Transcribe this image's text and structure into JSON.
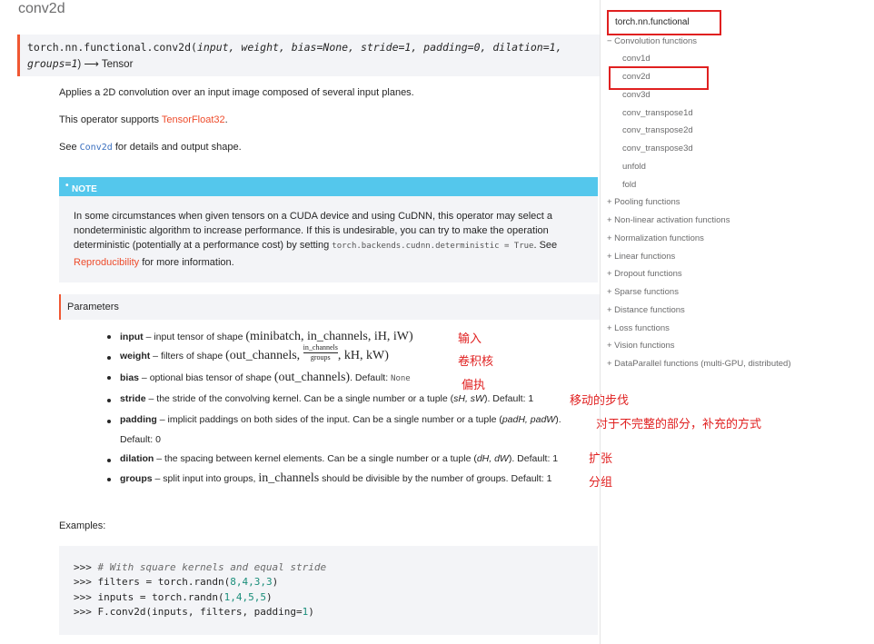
{
  "page": {
    "title": "conv2d"
  },
  "signature": {
    "prefix": "torch.nn.functional.conv2d(",
    "args_line1": "input, weight, bias=None, stride=1, padding=0, dilation=1,",
    "args_line2": "groups=1",
    "suffix": ") ⟶ Tensor"
  },
  "desc": {
    "line1": "Applies a 2D convolution over an input image composed of several input planes.",
    "line2_pre": "This operator supports ",
    "line2_link": "TensorFloat32",
    "line2_post": ".",
    "line3_pre": "See ",
    "line3_code": "Conv2d",
    "line3_post": " for details and output shape."
  },
  "note": {
    "heading": "NOTE",
    "l1": "In some circumstances when given tensors on a CUDA device and using CuDNN, this operator may select a",
    "l2": "nondeterministic algorithm to increase performance. If this is undesirable, you can try to make the operation",
    "l3_pre": "deterministic (potentially at a performance cost) by setting ",
    "l3_code": "torch.backends.cudnn.deterministic = True",
    "l3_post": ". See",
    "l4_link": "Reproducibility",
    "l4_post": " for more information."
  },
  "parameters": {
    "heading": "Parameters",
    "items": [
      {
        "name": "input",
        "sep": " – ",
        "desc": "input tensor of shape ",
        "math": "(minibatch, in_channels, iH, iW)"
      },
      {
        "name": "weight",
        "sep": " – ",
        "desc": "filters of shape ",
        "math_pre": "(out_channels, ",
        "frac_num": "in_channels",
        "frac_den": "groups",
        "math_post": ", kH, kW)"
      },
      {
        "name": "bias",
        "sep": " – ",
        "desc": "optional bias tensor of shape ",
        "math": "(out_channels)",
        "after": ". Default: ",
        "default_code": "None"
      },
      {
        "name": "stride",
        "sep": " – ",
        "desc": "the stride of the convolving kernel. Can be a single number or a tuple (",
        "math_it": "sH, sW",
        "after": "). Default: 1"
      },
      {
        "name": "padding",
        "sep": " – ",
        "desc": "implicit paddings on both sides of the input. Can be a single number or a tuple (",
        "math_it": "padH, padW",
        "after": ").",
        "cont": "Default: 0"
      },
      {
        "name": "dilation",
        "sep": " – ",
        "desc": "the spacing between kernel elements. Can be a single number or a tuple (",
        "math_it": "dH, dW",
        "after": "). Default: 1"
      },
      {
        "name": "groups",
        "sep": " – ",
        "desc": "split input into groups, ",
        "math": "in_channels",
        "after": " should be divisible by the number of groups. Default: 1"
      }
    ]
  },
  "annotations": [
    "输入",
    "卷积核",
    "偏执",
    "移动的步伐",
    "对于不完整的部分，补充的方式",
    "扩张",
    "分组"
  ],
  "examples": {
    "label": "Examples:",
    "lines": [
      {
        "prompt": ">>> ",
        "comment": "# With square kernels and equal stride"
      },
      {
        "prompt": ">>> ",
        "pre": "filters = torch.randn(",
        "nums": "8,4,3,3",
        "post": ")"
      },
      {
        "prompt": ">>> ",
        "pre": "inputs = torch.randn(",
        "nums": "1,4,5,5",
        "post": ")"
      },
      {
        "prompt": ">>> ",
        "pre": "F.conv2d(inputs, filters, padding=",
        "nums": "1",
        "post": ")"
      }
    ]
  },
  "toc": {
    "root": "torch.nn.functional",
    "items": [
      "− Convolution functions",
      "conv1d",
      "conv2d",
      "conv3d",
      "conv_transpose1d",
      "conv_transpose2d",
      "conv_transpose3d",
      "unfold",
      "fold",
      "+ Pooling functions",
      "+ Non-linear activation functions",
      "+ Normalization functions",
      "+ Linear functions",
      "+ Dropout functions",
      "+ Sparse functions",
      "+ Distance functions",
      "+ Loss functions",
      "+ Vision functions",
      "+ DataParallel functions (multi-GPU, distributed)"
    ]
  },
  "colors": {
    "accent": "#ee4c2c",
    "note_header": "#54c7ec",
    "annotation": "#e02020"
  }
}
